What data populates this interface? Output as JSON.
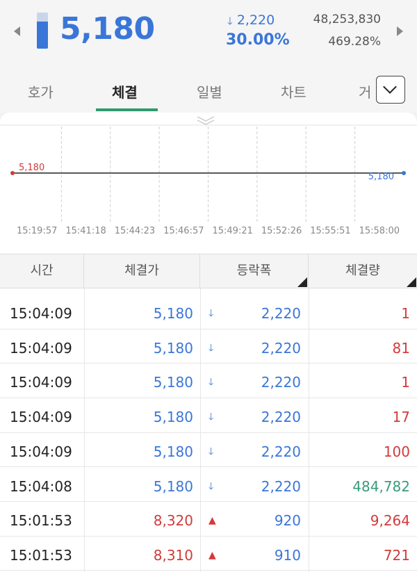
{
  "header": {
    "price": "5,180",
    "change": "2,220",
    "change_direction_icon": "down-arrow-icon",
    "change_rate": "30.00%",
    "volume": "48,253,830",
    "volume_ratio": "469.28%",
    "price_level_fraction": 0.75
  },
  "tabs": [
    {
      "label": "호가"
    },
    {
      "label": "체결"
    },
    {
      "label": "일별"
    },
    {
      "label": "차트"
    },
    {
      "label": "거"
    }
  ],
  "tab_more_icon": "chevron-down-icon",
  "chart_data": {
    "type": "line",
    "series": [
      {
        "values": [
          5180,
          5180
        ]
      }
    ],
    "x": [
      "15:19:57",
      "15:58:00"
    ],
    "tick_labels": [
      "15:19:57",
      "15:41:18",
      "15:44:23",
      "15:46:57",
      "15:49:21",
      "15:52:26",
      "15:55:51",
      "15:58:00"
    ],
    "start_label": "5,180",
    "end_label": "5,180",
    "grid": true,
    "colors": {
      "line": "#222222",
      "start": "#d33a3a",
      "end": "#3a76d8"
    }
  },
  "table": {
    "headers": [
      "시간",
      "체결가",
      "등락폭",
      "체결량"
    ],
    "rows": [
      {
        "time": "15:04:09",
        "price": "5,180",
        "dir": "down",
        "diff": "2,220",
        "qty": "1",
        "qty_color": "red"
      },
      {
        "time": "15:04:09",
        "price": "5,180",
        "dir": "down",
        "diff": "2,220",
        "qty": "81",
        "qty_color": "red"
      },
      {
        "time": "15:04:09",
        "price": "5,180",
        "dir": "down",
        "diff": "2,220",
        "qty": "1",
        "qty_color": "red"
      },
      {
        "time": "15:04:09",
        "price": "5,180",
        "dir": "down",
        "diff": "2,220",
        "qty": "17",
        "qty_color": "red"
      },
      {
        "time": "15:04:09",
        "price": "5,180",
        "dir": "down",
        "diff": "2,220",
        "qty": "100",
        "qty_color": "red"
      },
      {
        "time": "15:04:08",
        "price": "5,180",
        "dir": "down",
        "diff": "2,220",
        "qty": "484,782",
        "qty_color": "green"
      },
      {
        "time": "15:01:53",
        "price": "8,320",
        "dir": "up",
        "diff": "920",
        "qty": "9,264",
        "qty_color": "red"
      },
      {
        "time": "15:01:53",
        "price": "8,310",
        "dir": "up",
        "diff": "910",
        "qty": "721",
        "qty_color": "red"
      }
    ]
  }
}
